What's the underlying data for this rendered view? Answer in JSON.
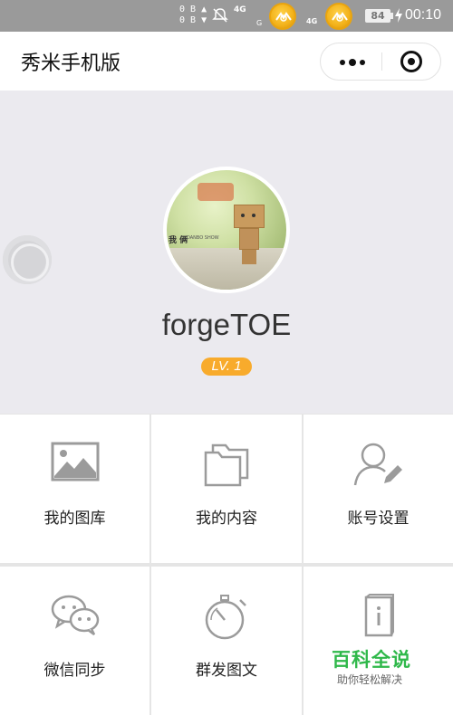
{
  "status_bar": {
    "net_speed_up": "0 B",
    "net_speed_down": "0 B",
    "signal_label_1": "4G",
    "signal_label_2": "4G",
    "sim_label": "G",
    "battery": "84",
    "time": "00:10"
  },
  "nav": {
    "title": "秀米手机版"
  },
  "profile": {
    "avatar_caption": "我 俩",
    "avatar_caption_small": "DANBO SHOW",
    "username": "forgeTOE",
    "level": "LV. 1"
  },
  "menu": [
    {
      "label": "我的图库",
      "icon": "image-icon"
    },
    {
      "label": "我的内容",
      "icon": "folder-icon"
    },
    {
      "label": "账号设置",
      "icon": "user-edit-icon"
    },
    {
      "label": "微信同步",
      "icon": "wechat-icon"
    },
    {
      "label": "群发图文",
      "icon": "stopwatch-icon"
    },
    {
      "label": "",
      "icon": "info-book-icon"
    }
  ],
  "watermark": {
    "title": "百科全说",
    "subtitle": "助你轻松解决"
  },
  "colors": {
    "level_badge": "#f8ab2c",
    "watermark_green": "#2fb84a",
    "header_bg": "#ebeaef"
  }
}
